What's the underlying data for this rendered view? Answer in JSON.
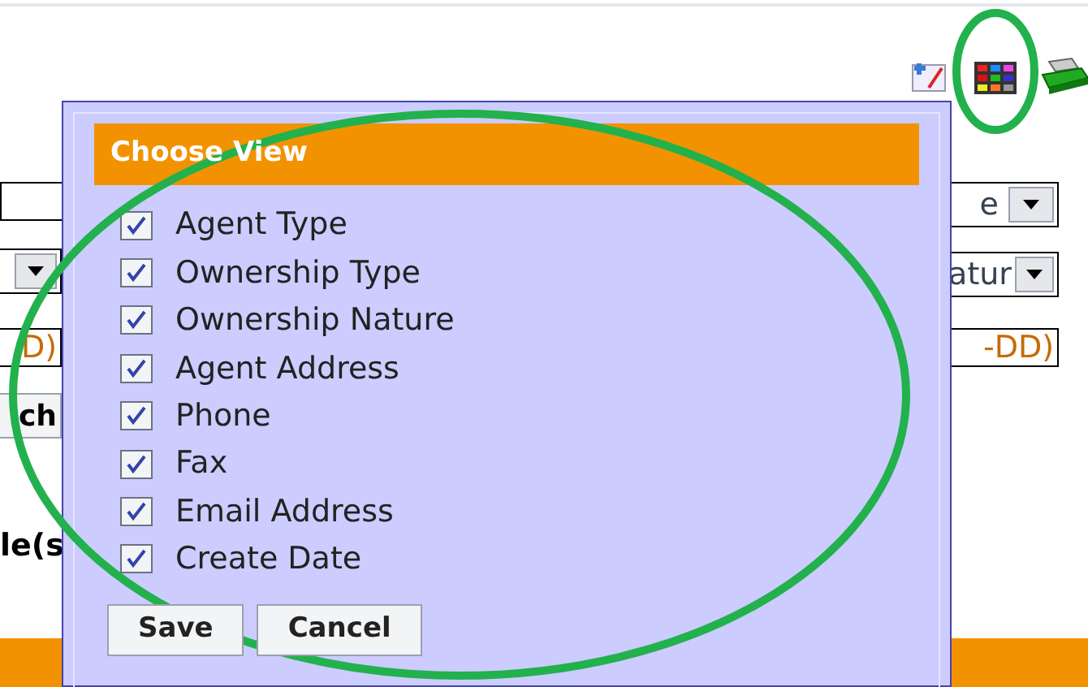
{
  "background": {
    "left": {
      "field_text": "D)",
      "button": "ch",
      "heading": "le(s"
    },
    "right": {
      "select_1": "e",
      "select_2": "atur",
      "field_text": "-DD)"
    }
  },
  "choose_view": {
    "title": "Choose View",
    "items": [
      {
        "label": "Agent Type",
        "checked": true
      },
      {
        "label": "Ownership Type",
        "checked": true
      },
      {
        "label": "Ownership Nature",
        "checked": true
      },
      {
        "label": "Agent Address",
        "checked": true
      },
      {
        "label": "Phone",
        "checked": true
      },
      {
        "label": "Fax",
        "checked": true
      },
      {
        "label": "Email Address",
        "checked": true
      },
      {
        "label": "Create Date",
        "checked": true
      }
    ],
    "buttons": [
      "Save",
      "Cancel"
    ]
  }
}
